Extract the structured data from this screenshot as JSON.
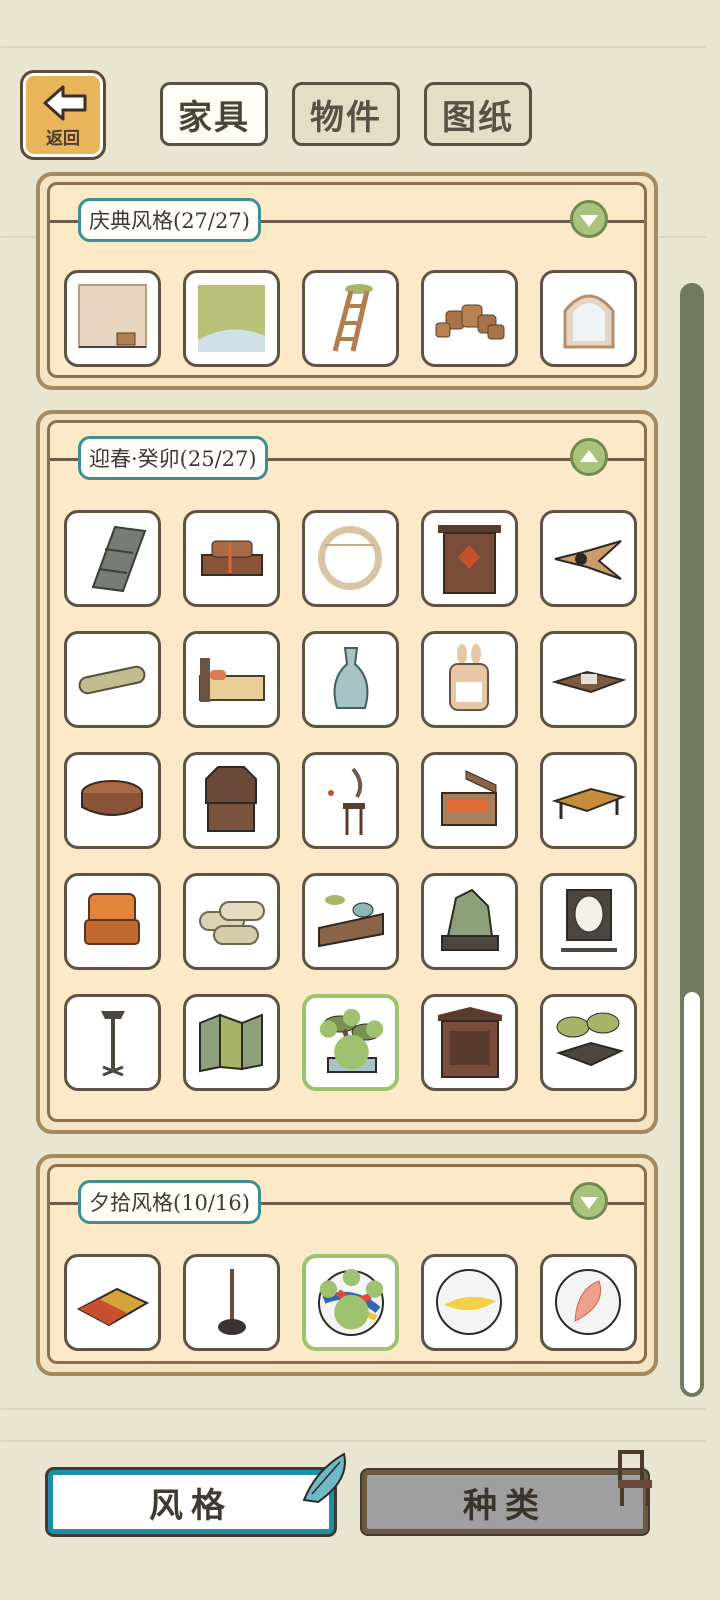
{
  "header": {
    "back": {
      "label": "返回"
    },
    "tabs": [
      {
        "label": "家具",
        "active": true
      },
      {
        "label": "物件",
        "active": false
      },
      {
        "label": "图纸",
        "active": false
      }
    ]
  },
  "sections": [
    {
      "title": "庆典风格(27/27)",
      "collapsed": true,
      "items": [
        "wall-panel-icon",
        "grass-floor-icon",
        "ladder-icon",
        "pots-icon",
        "arched-window-icon"
      ]
    },
    {
      "title": "迎春·癸卯(25/27)",
      "collapsed": false,
      "items": [
        "step-shelf-icon",
        "firewood-bench-icon",
        "round-window-icon",
        "red-door-icon",
        "swallow-kite-icon",
        "rolled-scroll-icon",
        "bed-icon",
        "vase-icon",
        "rabbit-calendar-icon",
        "low-tea-table-icon",
        "round-stool-icon",
        "octagonal-cabinet-icon",
        "plum-stand-icon",
        "open-chest-icon",
        "long-bench-icon",
        "armchair-icon",
        "scrolls-icon",
        "tea-set-icon",
        "rockery-icon",
        "mirror-stand-icon",
        "lamp-stand-icon",
        "folding-screen-icon",
        "bonsai-icon",
        "wardrobe-icon",
        "bonsai-tray-icon"
      ],
      "selected_index": 22
    },
    {
      "title": "夕拾风格(10/16)",
      "collapsed": true,
      "items": [
        "rug-icon",
        "stand-pole-icon",
        "marble-red-icon",
        "marble-yellow-icon",
        "marble-shell-icon"
      ],
      "selected_index": 2
    }
  ],
  "footer": {
    "tabs": [
      {
        "label": "风格",
        "active": true
      },
      {
        "label": "种类",
        "active": false
      }
    ]
  },
  "colors": {
    "accent": "#1f8fa6",
    "selected": "#9ec270",
    "panel": "#fbe9c7",
    "panel_border": "#a48a5e"
  }
}
